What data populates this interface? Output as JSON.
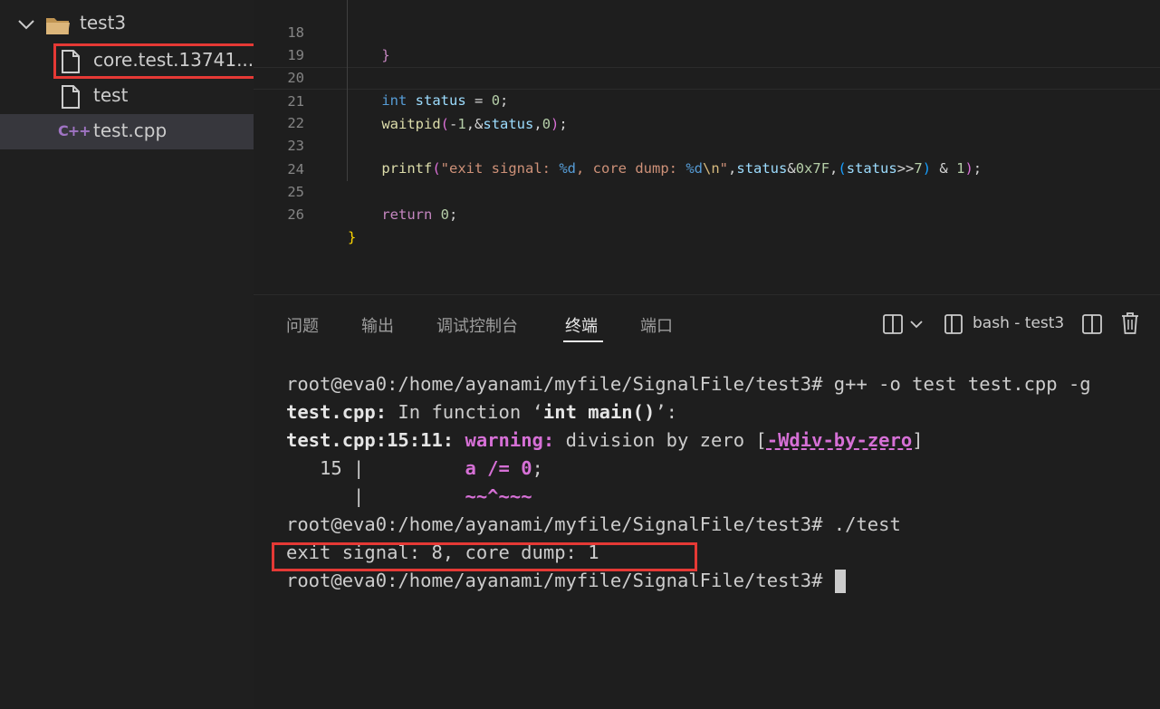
{
  "explorer": {
    "folder": {
      "label": "test3",
      "expanded": true
    },
    "files": [
      {
        "label": "core.test.13741...",
        "icon": "file-icon",
        "highlighted": true
      },
      {
        "label": "test",
        "icon": "file-icon"
      },
      {
        "label": "test.cpp",
        "icon": "cpp-icon",
        "icon_text": "C++",
        "selected": true
      }
    ]
  },
  "editor": {
    "line_numbers": [
      "18",
      "19",
      "20",
      "21",
      "22",
      "23",
      "24",
      "25",
      "26"
    ],
    "current_line": "21"
  },
  "panel": {
    "tabs": [
      "问题",
      "输出",
      "调试控制台",
      "终端",
      "端口"
    ],
    "active_tab": "终端",
    "terminal_name": "bash - test3"
  },
  "terminal": {
    "prompt": "root@eva0:/home/ayanami/myfile/SignalFile/test3#",
    "cmd1": " g++ -o test test.cpp -g",
    "l2_file": "test.cpp:",
    "l2_rest_a": " In function ‘",
    "l2_func": "int main()",
    "l2_rest_b": "’:",
    "l3_loc": "test.cpp:15:11:",
    "l3_warn": " warning:",
    "l3_msg": " division by zero [",
    "l3_flag": "-Wdiv-by-zero",
    "l3_close": "]",
    "l4_num": "   15 |         ",
    "l4_code": "a /= 0",
    "l4_semi": ";",
    "l5_bar": "      |         ",
    "l5_marker": "~~^~~~",
    "cmd2": " ./test",
    "output": "exit signal: 8, core dump: 1"
  },
  "colors": {
    "highlight_box": "#e53935",
    "accent": "#d670d6"
  }
}
